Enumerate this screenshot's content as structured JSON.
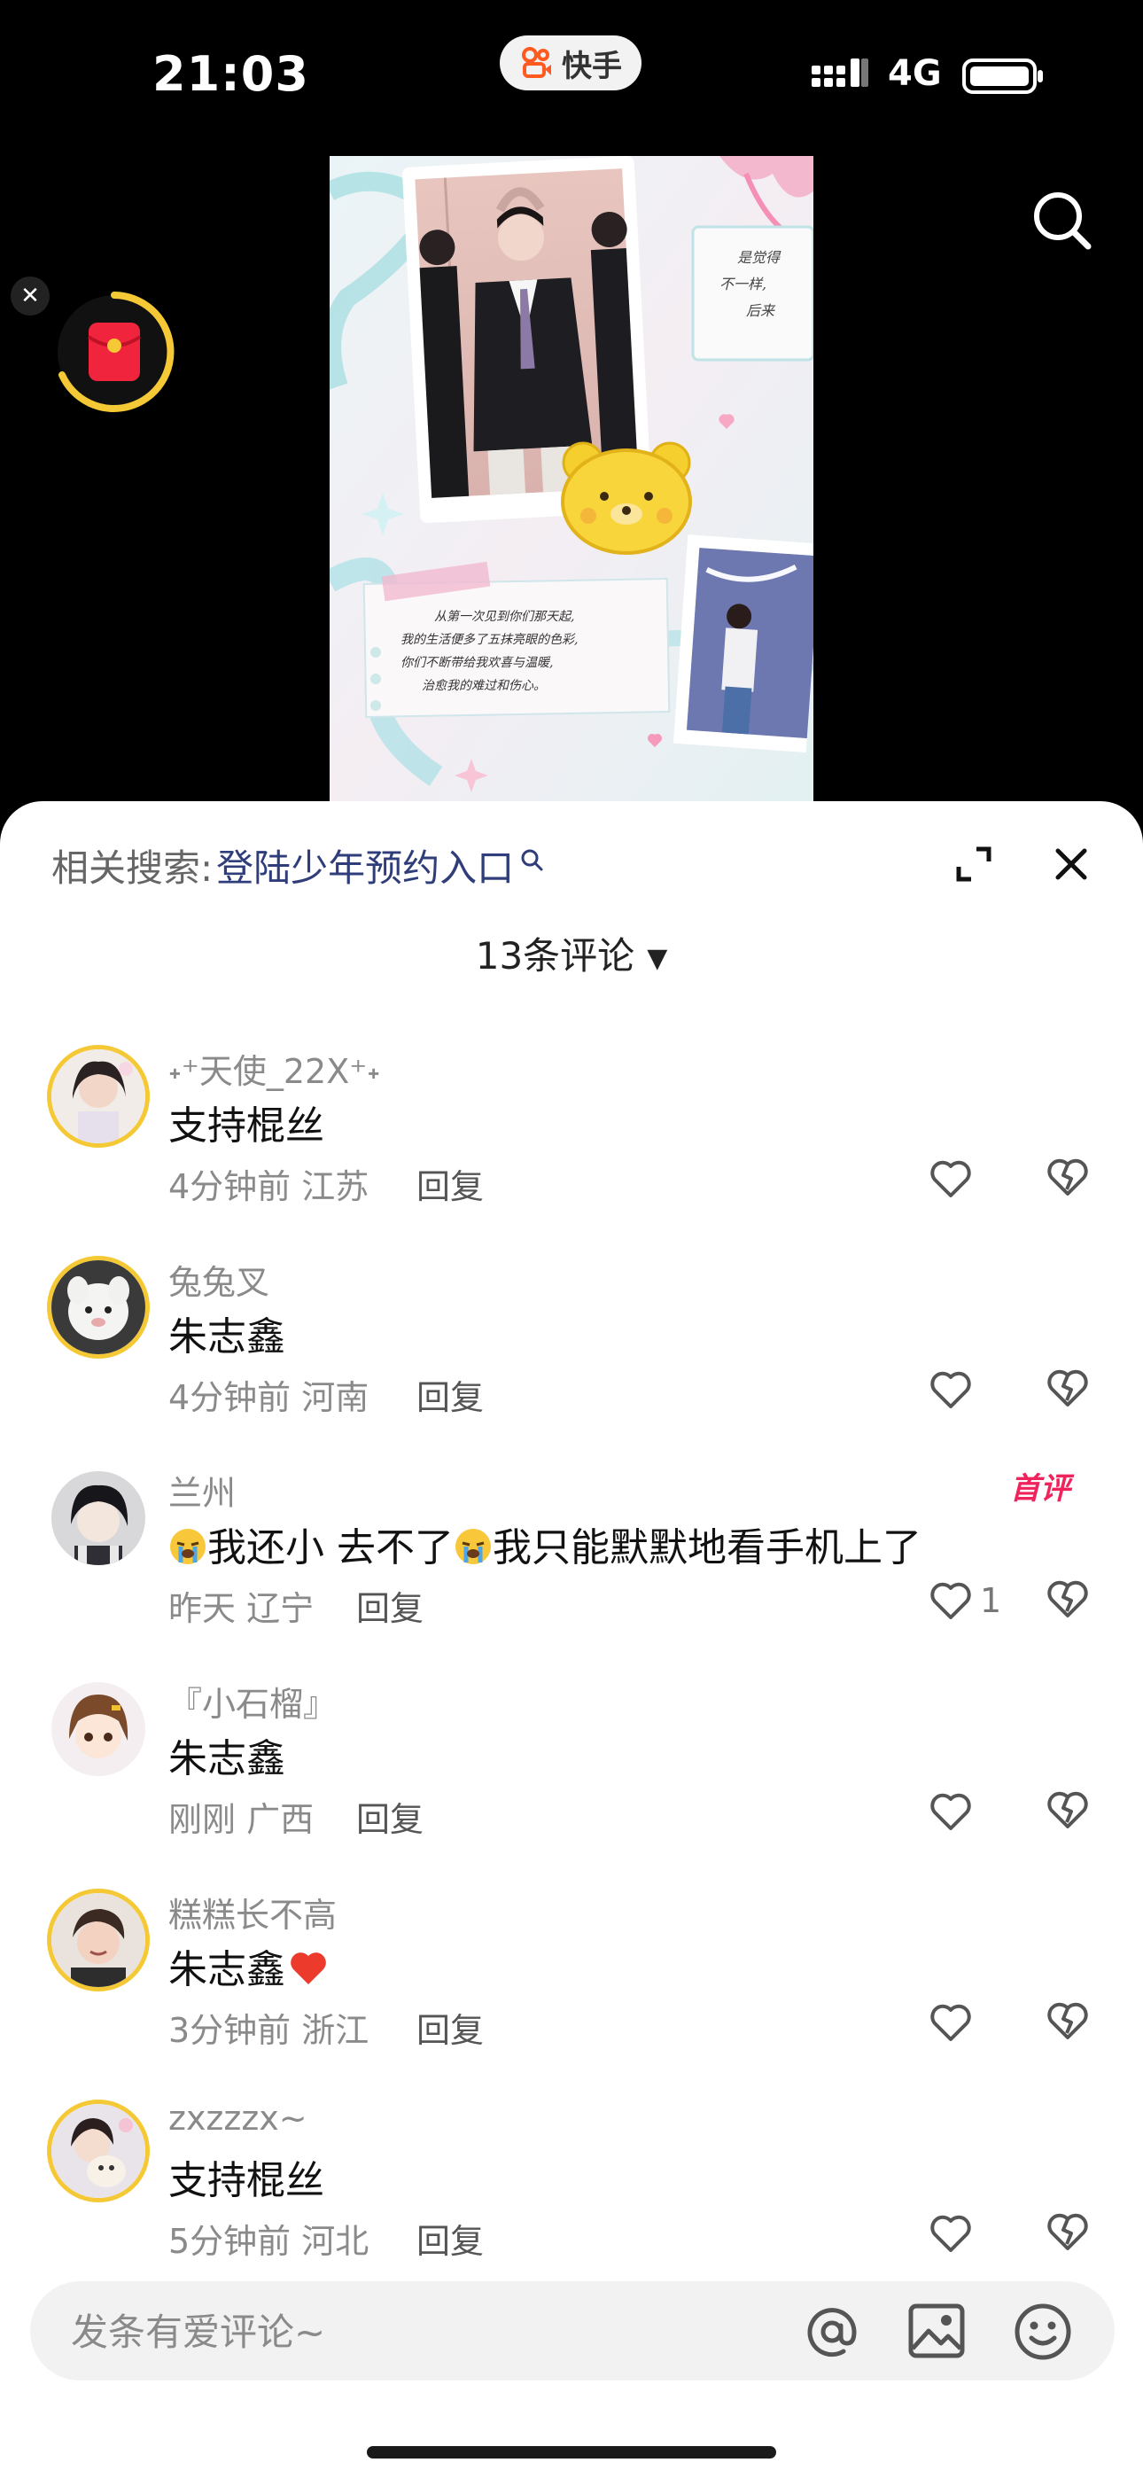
{
  "status_bar": {
    "time": "21:03",
    "app_name": "快手",
    "network": "4G"
  },
  "video": {
    "caption_lines": [
      "从第一次见到你们那天起,",
      "我的生活便多了五抹亮眼的色彩,",
      "你们不断带给我欢喜与温暖,",
      "治愈我的难过和伤心。"
    ]
  },
  "sheet": {
    "related_label": "相关搜索:",
    "related_term": "登陆少年预约入口",
    "count_label": "13条评论",
    "caret": "▼"
  },
  "comments": [
    {
      "user": "˖⁺天使_22X⁺˖",
      "text": "支持棍丝",
      "time": "4分钟前",
      "location": "江苏",
      "reply": "回复",
      "likes": ""
    },
    {
      "user": "兔兔叉",
      "text": "朱志鑫",
      "time": "4分钟前",
      "location": "河南",
      "reply": "回复",
      "likes": ""
    },
    {
      "user": "兰州",
      "text_before": "",
      "text_mid": "我还小 去不了",
      "text_after": "我只能默默地看手机上了",
      "time": "昨天",
      "location": "辽宁",
      "reply": "回复",
      "likes": "1",
      "badge": "首评"
    },
    {
      "user": "『小石榴』",
      "text": "朱志鑫",
      "time": "刚刚",
      "location": "广西",
      "reply": "回复",
      "likes": ""
    },
    {
      "user": "糕糕长不高",
      "text": "朱志鑫",
      "time": "3分钟前",
      "location": "浙江",
      "reply": "回复",
      "likes": ""
    },
    {
      "user": "zxzzzx~",
      "text": "支持棍丝",
      "time": "5分钟前",
      "location": "河北",
      "reply": "回复",
      "likes": ""
    }
  ],
  "input": {
    "placeholder": "发条有爱评论~"
  },
  "icons": [
    "search-icon",
    "expand-icon",
    "close-icon",
    "heart-icon",
    "dislike-heart-icon",
    "at-icon",
    "image-icon",
    "emoji-icon"
  ],
  "colors": {
    "accent_ring": "#f4c935",
    "badge": "#f0245c",
    "link": "#2f3e7a"
  }
}
